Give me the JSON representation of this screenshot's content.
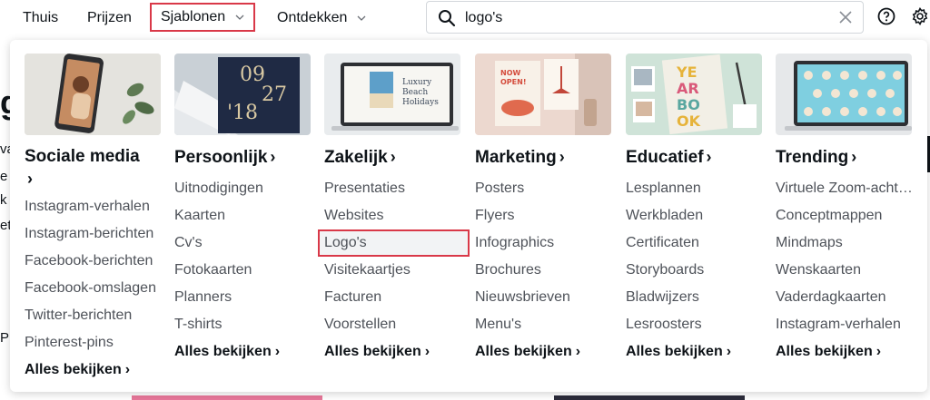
{
  "nav": {
    "items": [
      {
        "id": "home",
        "label": "Thuis"
      },
      {
        "id": "pricing",
        "label": "Prijzen"
      },
      {
        "id": "templates",
        "label": "Sjablonen"
      },
      {
        "id": "discover",
        "label": "Ontdekken"
      }
    ],
    "search_value": "logo's",
    "icons": [
      "search-icon",
      "clear-icon",
      "help-icon",
      "settings-icon"
    ]
  },
  "background_fragments": [
    "go",
    "va",
    "e",
    "k",
    "et",
    "P"
  ],
  "menu": {
    "columns": [
      {
        "title": "Sociale media",
        "links": [
          "Instagram-verhalen",
          "Instagram-berichten",
          "Facebook-berichten",
          "Facebook-omslagen",
          "Twitter-berichten",
          "Pinterest-pins"
        ],
        "see_all": "Alles bekijken"
      },
      {
        "title": "Persoonlijk",
        "thumb_text": [
          "09",
          "27",
          "'18"
        ],
        "links": [
          "Uitnodigingen",
          "Kaarten",
          "Cv's",
          "Fotokaarten",
          "Planners",
          "T-shirts"
        ],
        "see_all": "Alles bekijken"
      },
      {
        "title": "Zakelijk",
        "thumb_text": [
          "Luxury",
          "Beach",
          "Holidays"
        ],
        "links": [
          "Presentaties",
          "Websites",
          "Logo's",
          "Visitekaartjes",
          "Facturen",
          "Voorstellen"
        ],
        "highlighted": "Logo's",
        "see_all": "Alles bekijken"
      },
      {
        "title": "Marketing",
        "thumb_text": [
          "NOW",
          "OPEN!"
        ],
        "links": [
          "Posters",
          "Flyers",
          "Infographics",
          "Brochures",
          "Nieuwsbrieven",
          "Menu's"
        ],
        "see_all": "Alles bekijken"
      },
      {
        "title": "Educatief",
        "thumb_text": [
          "YE",
          "AR",
          "BO",
          "OK"
        ],
        "links": [
          "Lesplannen",
          "Werkbladen",
          "Certificaten",
          "Storyboards",
          "Bladwijzers",
          "Lesroosters"
        ],
        "see_all": "Alles bekijken"
      },
      {
        "title": "Trending",
        "links": [
          "Virtuele Zoom-achtergronden",
          "Conceptmappen",
          "Mindmaps",
          "Wenskaarten",
          "Vaderdagkaarten",
          "Instagram-verhalen"
        ],
        "see_all": "Alles bekijken"
      }
    ]
  },
  "colors": {
    "highlight": "#d93848",
    "text": "#0e1318",
    "muted": "#4e5259"
  }
}
